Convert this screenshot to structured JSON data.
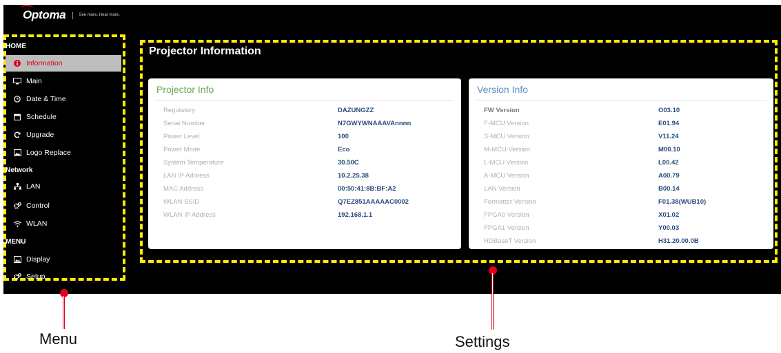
{
  "brand": {
    "logo": "Optoma",
    "tagline": "See more. Hear more."
  },
  "menu": {
    "sections": [
      {
        "title": "HOME",
        "items": [
          {
            "label": "Information",
            "icon": "info-icon",
            "active": true
          },
          {
            "label": "Main",
            "icon": "monitor-icon"
          },
          {
            "label": "Date & Time",
            "icon": "clock-icon"
          },
          {
            "label": "Schedule",
            "icon": "calendar-icon"
          },
          {
            "label": "Upgrade",
            "icon": "refresh-icon"
          },
          {
            "label": "Logo Replace",
            "icon": "image-icon"
          }
        ]
      },
      {
        "title": "Network",
        "items": [
          {
            "label": "LAN",
            "icon": "network-icon"
          },
          {
            "label": "Control",
            "icon": "gears-icon"
          },
          {
            "label": "WLAN",
            "icon": "wifi-icon"
          }
        ]
      },
      {
        "title": "MENU",
        "items": [
          {
            "label": "Display",
            "icon": "image-icon"
          },
          {
            "label": "Setup",
            "icon": "gears-icon"
          }
        ]
      }
    ]
  },
  "page_title": "Projector Information",
  "projector_info": {
    "title": "Projector Info",
    "rows": [
      {
        "label": "Regulatory",
        "value": "DAZUNGZZ"
      },
      {
        "label": "Serial Number",
        "value": "N7GWYWNAAAVAnnnn"
      },
      {
        "label": "Power Level",
        "value": "100"
      },
      {
        "label": "Power Mode",
        "value": "Eco"
      },
      {
        "label": "System Temperature",
        "value": "30.50C"
      },
      {
        "label": "LAN IP Address",
        "value": "10.2.25.38"
      },
      {
        "label": "MAC Address",
        "value": "00:50:41:8B:BF:A2"
      },
      {
        "label": "WLAN SSID",
        "value": "Q7EZ851AAAAAC0002"
      },
      {
        "label": "WLAN IP Address",
        "value": "192.168.1.1"
      }
    ]
  },
  "version_info": {
    "title": "Version Info",
    "rows": [
      {
        "label": "FW Version",
        "value": "O03.10"
      },
      {
        "label": "F-MCU Version",
        "value": "E01.94"
      },
      {
        "label": "S-MCU Version",
        "value": "V11.24"
      },
      {
        "label": "M-MCU Version",
        "value": "M00.10"
      },
      {
        "label": "L-MCU Version",
        "value": "L00.42"
      },
      {
        "label": "A-MCU Version",
        "value": "A00.79"
      },
      {
        "label": "LAN Version",
        "value": "B00.14"
      },
      {
        "label": "Formatter Version",
        "value": "F01.38(WUB10)"
      },
      {
        "label": "FPGA0 Version",
        "value": "X01.02"
      },
      {
        "label": "FPGA1 Version",
        "value": "Y00.03"
      },
      {
        "label": "HDBaseT Version",
        "value": "H31.20.00.0B"
      }
    ]
  },
  "callouts": {
    "menu": "Menu",
    "settings": "Settings"
  },
  "colors": {
    "accent": "#d6001c",
    "highlight": "#ffeb00",
    "green_title": "#6aa84f",
    "blue_title": "#5b8fc7"
  }
}
